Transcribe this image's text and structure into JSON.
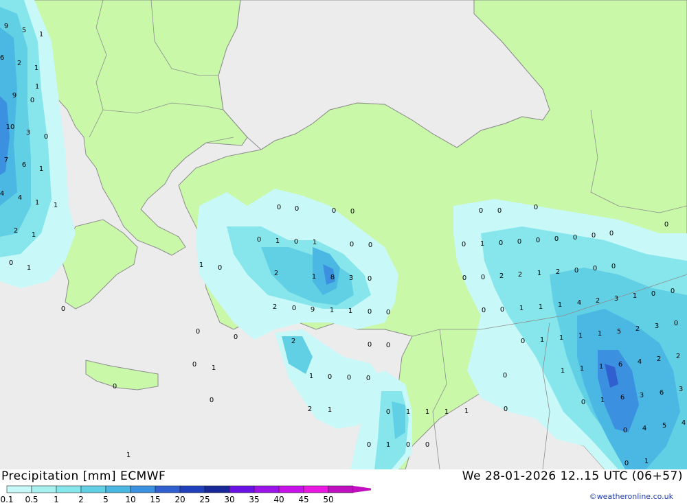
{
  "title": "Precipitation [mm] ECMWF",
  "datetime": "We 28-01-2026 12..15 UTC (06+57)",
  "credit": "©weatheronline.co.uk",
  "legend": {
    "ticks": [
      "0.1",
      "0.5",
      "1",
      "2",
      "5",
      "10",
      "15",
      "20",
      "25",
      "30",
      "35",
      "40",
      "45",
      "50"
    ],
    "colors": [
      "#c8f8f8",
      "#a6f0f0",
      "#86e6ec",
      "#62d0e4",
      "#4ab8e2",
      "#3c90e0",
      "#3060d0",
      "#2040bc",
      "#182898",
      "#6a12e6",
      "#9a14ea",
      "#c812ea",
      "#e818e0",
      "#c010c0"
    ]
  },
  "colors": {
    "sea": "#ececec",
    "land": "#c8f8a8",
    "border": "#8c8c8c"
  },
  "precip_values": [
    "9",
    "5",
    "1",
    "6",
    "2",
    "1",
    "1",
    "9",
    "0",
    "10",
    "3",
    "0",
    "7",
    "6",
    "1",
    "4",
    "4",
    "1",
    "1",
    "2",
    "1",
    "0",
    "1",
    "0",
    "0",
    "0",
    "0",
    "0",
    "0",
    "1",
    "0",
    "1",
    "0",
    "0",
    "1",
    "0",
    "2",
    "1",
    "8",
    "3",
    "0",
    "2",
    "0",
    "9",
    "1",
    "1",
    "0",
    "0",
    "0",
    "2",
    "0",
    "0",
    "0",
    "0",
    "1",
    "1",
    "0",
    "0",
    "0",
    "0",
    "0",
    "0",
    "0",
    "0",
    "0",
    "0",
    "1",
    "0",
    "0",
    "0",
    "0",
    "0",
    "0",
    "0",
    "0",
    "0",
    "2",
    "2",
    "1",
    "2",
    "0",
    "0",
    "0",
    "1",
    "0",
    "0",
    "0",
    "0",
    "1",
    "1",
    "1",
    "4",
    "2",
    "3",
    "0",
    "1",
    "1",
    "1",
    "1",
    "5",
    "2",
    "3",
    "0",
    "1",
    "1",
    "1",
    "6",
    "4",
    "2",
    "2",
    "0",
    "0",
    "1",
    "6",
    "3",
    "6",
    "3",
    "2",
    "0",
    "1",
    "1",
    "1",
    "1",
    "0",
    "4",
    "5",
    "4",
    "1",
    "0",
    "1",
    "1",
    "0",
    "0",
    "0",
    "0",
    "1",
    "0"
  ]
}
